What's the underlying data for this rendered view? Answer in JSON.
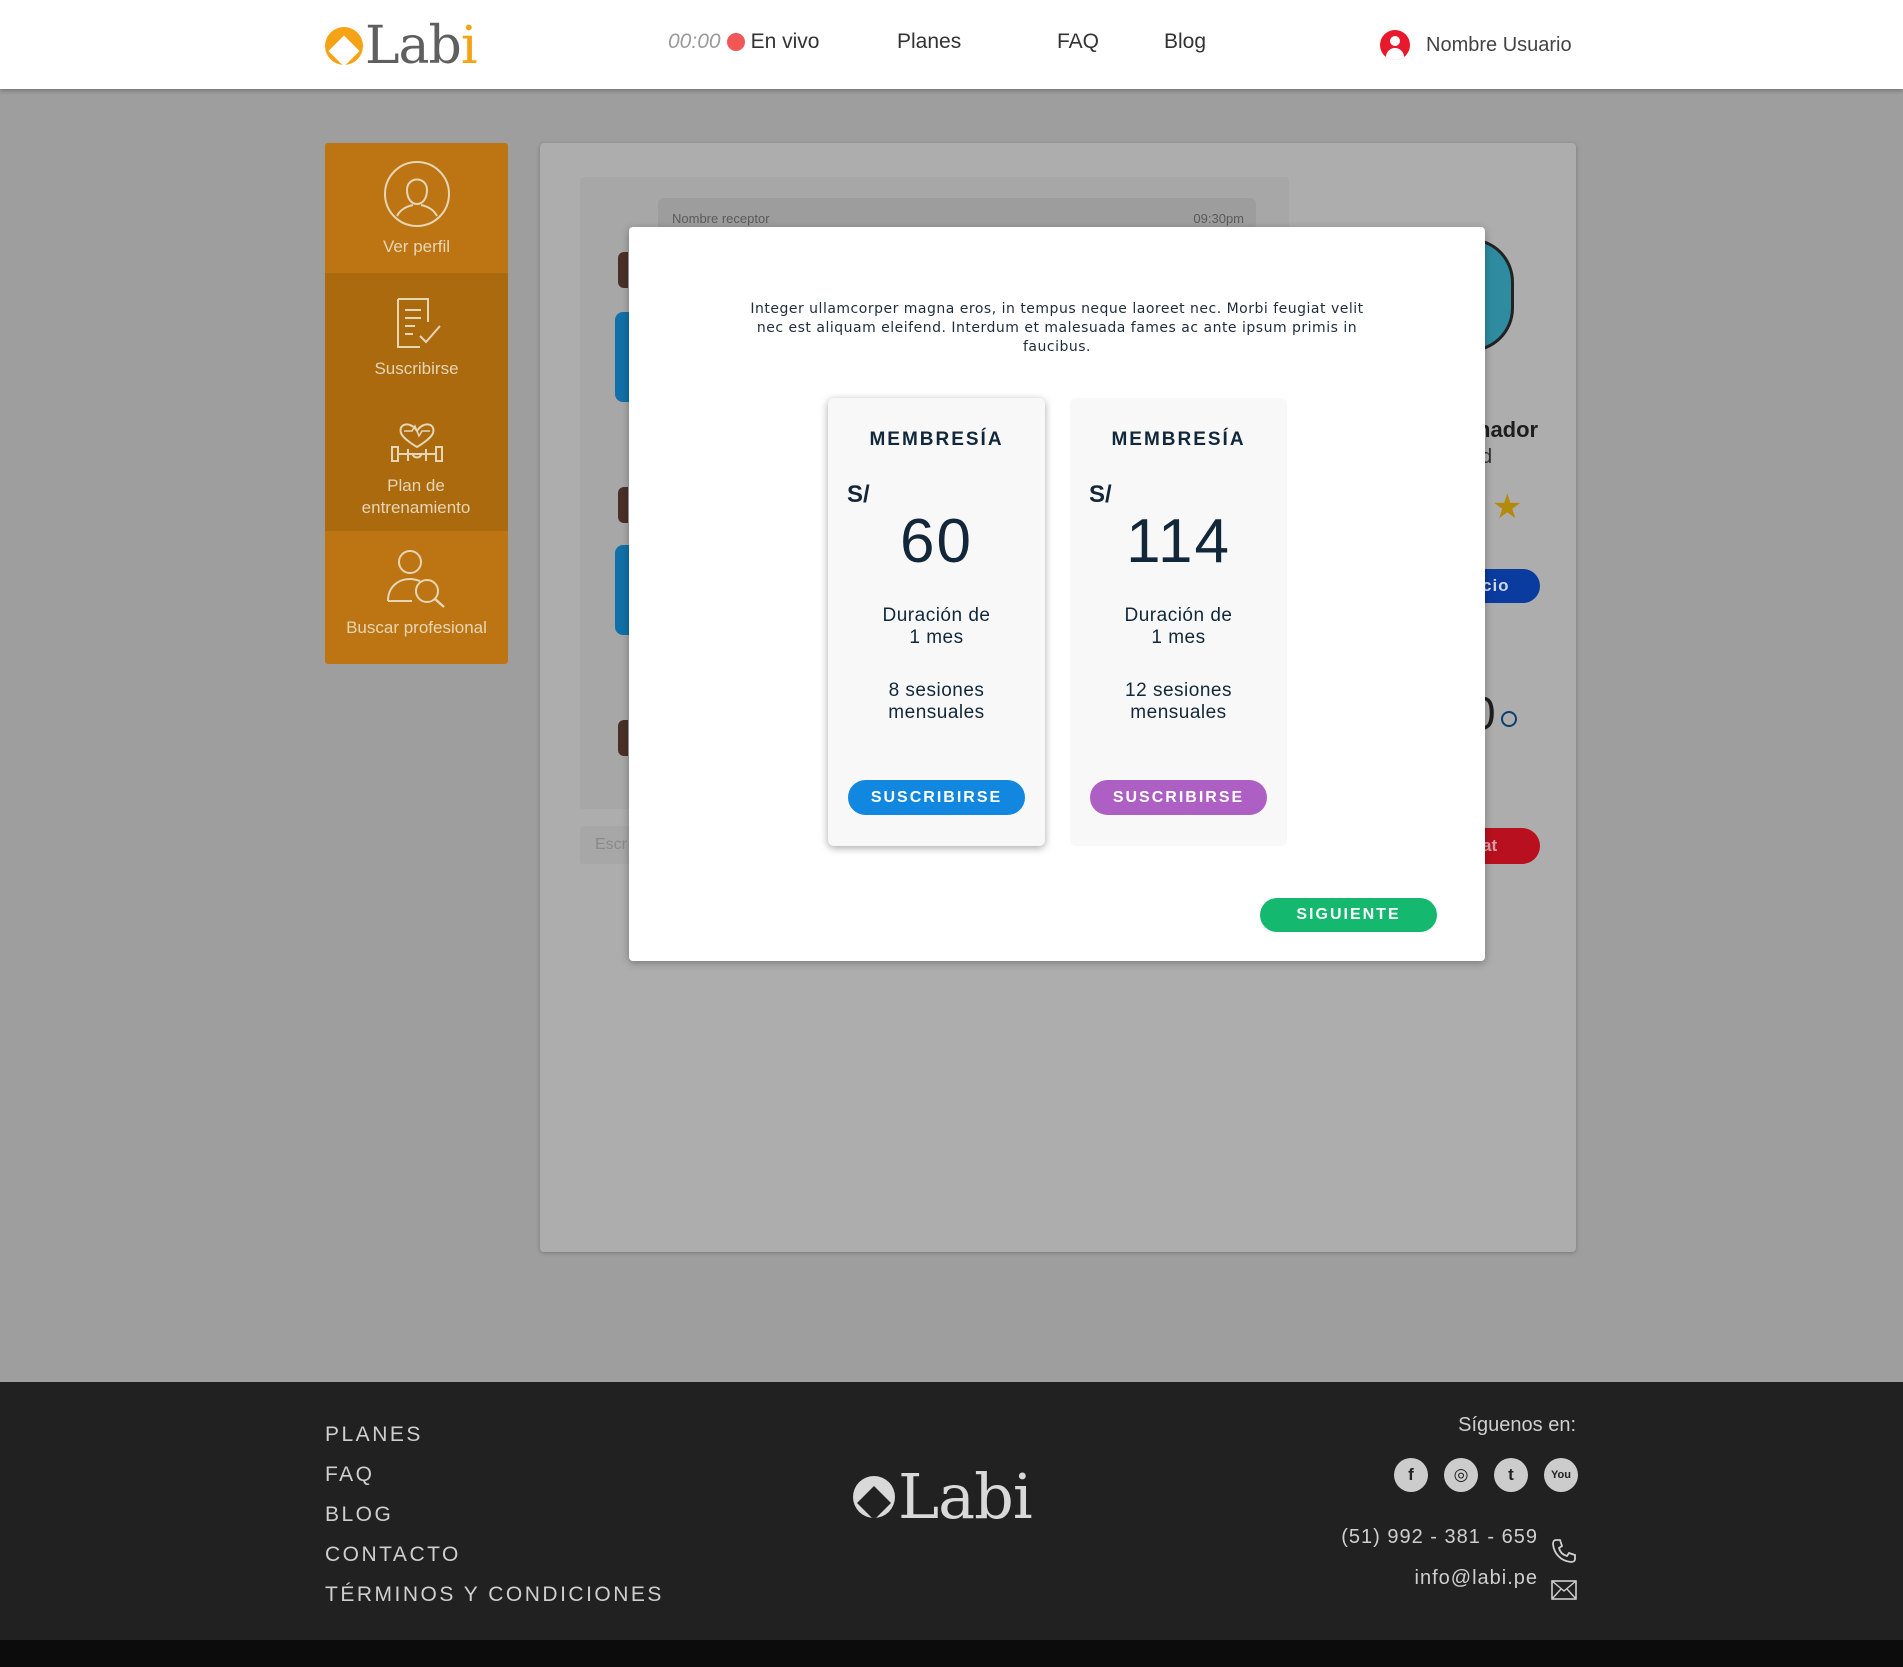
{
  "header": {
    "logo_text": "Lab",
    "logo_text_accent": "i",
    "live_time": "00:00",
    "live_label": "En vivo",
    "nav": {
      "planes": "Planes",
      "faq": "FAQ",
      "blog": "Blog"
    },
    "user_name": "Nombre Usuario"
  },
  "sidebar": {
    "items": [
      {
        "label": "Ver perfil",
        "icon": "user-outline-icon"
      },
      {
        "label": "Suscribirse",
        "icon": "document-check-icon"
      },
      {
        "label": "Plan de entrenamiento",
        "icon": "fitness-heart-icon"
      },
      {
        "label": "Buscar profesional",
        "icon": "user-search-icon"
      }
    ]
  },
  "background": {
    "message_header": {
      "name": "Nombre receptor",
      "time": "09:30pm"
    },
    "input_placeholder": "Escr",
    "trainer_name_fragment": "nador",
    "trainer_sub_fragment": "d",
    "blue_button_fragment": "cio",
    "number_fragment": "0",
    "red_button_fragment": "at"
  },
  "modal": {
    "description": "Integer ullamcorper magna eros, in tempus neque laoreet nec. Morbi feugiat velit nec est aliquam eleifend. Interdum et malesuada fames ac ante ipsum primis in faucibus.",
    "plans": [
      {
        "title": "MEMBRESÍA",
        "currency": "S/",
        "price": "60",
        "duration_line1": "Duración de",
        "duration_line2": "1 mes",
        "sessions_line1": "8 sesiones",
        "sessions_line2": "mensuales",
        "button": "SUSCRIBIRSE",
        "button_color": "#1287e0",
        "selected": true
      },
      {
        "title": "MEMBRESÍA",
        "currency": "S/",
        "price": "114",
        "duration_line1": "Duración de",
        "duration_line2": "1 mes",
        "sessions_line1": "12 sesiones",
        "sessions_line2": "mensuales",
        "button": "SUSCRIBIRSE",
        "button_color": "#ad5fc4",
        "selected": false
      }
    ],
    "next_button": "SIGUIENTE",
    "next_button_color": "#14b96f"
  },
  "footer": {
    "links": [
      "PLANES",
      "FAQ",
      "BLOG",
      "CONTACTO",
      "TÉRMINOS Y CONDICIONES"
    ],
    "logo_text": "Labi",
    "follow_label": "Síguenos en:",
    "social_icons": [
      "facebook-icon",
      "instagram-icon",
      "twitter-icon",
      "youtube-icon"
    ],
    "phone": "(51) 992 - 381 - 659",
    "email": "info@labi.pe"
  },
  "colors": {
    "brand_orange": "#f5a214",
    "sidebar_orange": "#bc7512",
    "live_red": "#f25757",
    "footer_bg": "#212121"
  }
}
